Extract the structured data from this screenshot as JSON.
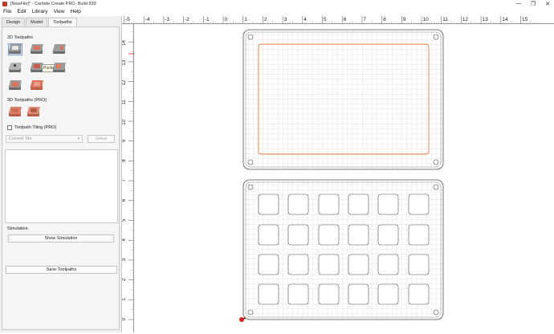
{
  "window": {
    "title": "[NewFile]* - Carbide Create PRO, Build 839",
    "controls": [
      "—",
      "❐",
      "✕"
    ]
  },
  "menu": [
    "File",
    "Edit",
    "Library",
    "View",
    "Help"
  ],
  "tabs": [
    "Design",
    "Model",
    "Toolpaths"
  ],
  "panel": {
    "toolpaths_2d_label": "2D Toolpaths",
    "tooltip": "Pocket",
    "toolpaths_3d_label": "3D Toolpaths (PRO)",
    "tiling_label": "Toolpath Tiling (PRO)",
    "tiling_checked": false,
    "current_tile_placeholder": "Current Tile",
    "setup_button": "Setup",
    "simulation_label": "Simulation",
    "show_simulation_button": "Show Simulation",
    "save_toolpaths_button": "Save Toolpaths"
  },
  "ruler": {
    "x_labels": [
      "-5",
      "-4",
      "-3",
      "-2",
      "-1",
      "0",
      "1",
      "2",
      "3",
      "4",
      "5",
      "6",
      "7",
      "8",
      "9",
      "10",
      "11",
      "12",
      "13",
      "14",
      "15"
    ],
    "y_labels": [
      "14",
      "13",
      "12",
      "11",
      "10",
      "9",
      "8",
      "7",
      "6",
      "5",
      "4",
      "3",
      "2",
      "1",
      "0"
    ]
  },
  "colors": {
    "accent_orange": "#f0803c",
    "origin_marker": "#e02020",
    "grid": "#e4e4e4",
    "part_outline": "#555555"
  },
  "design": {
    "pocket_grid_rows": 4,
    "pocket_grid_cols": 6
  }
}
